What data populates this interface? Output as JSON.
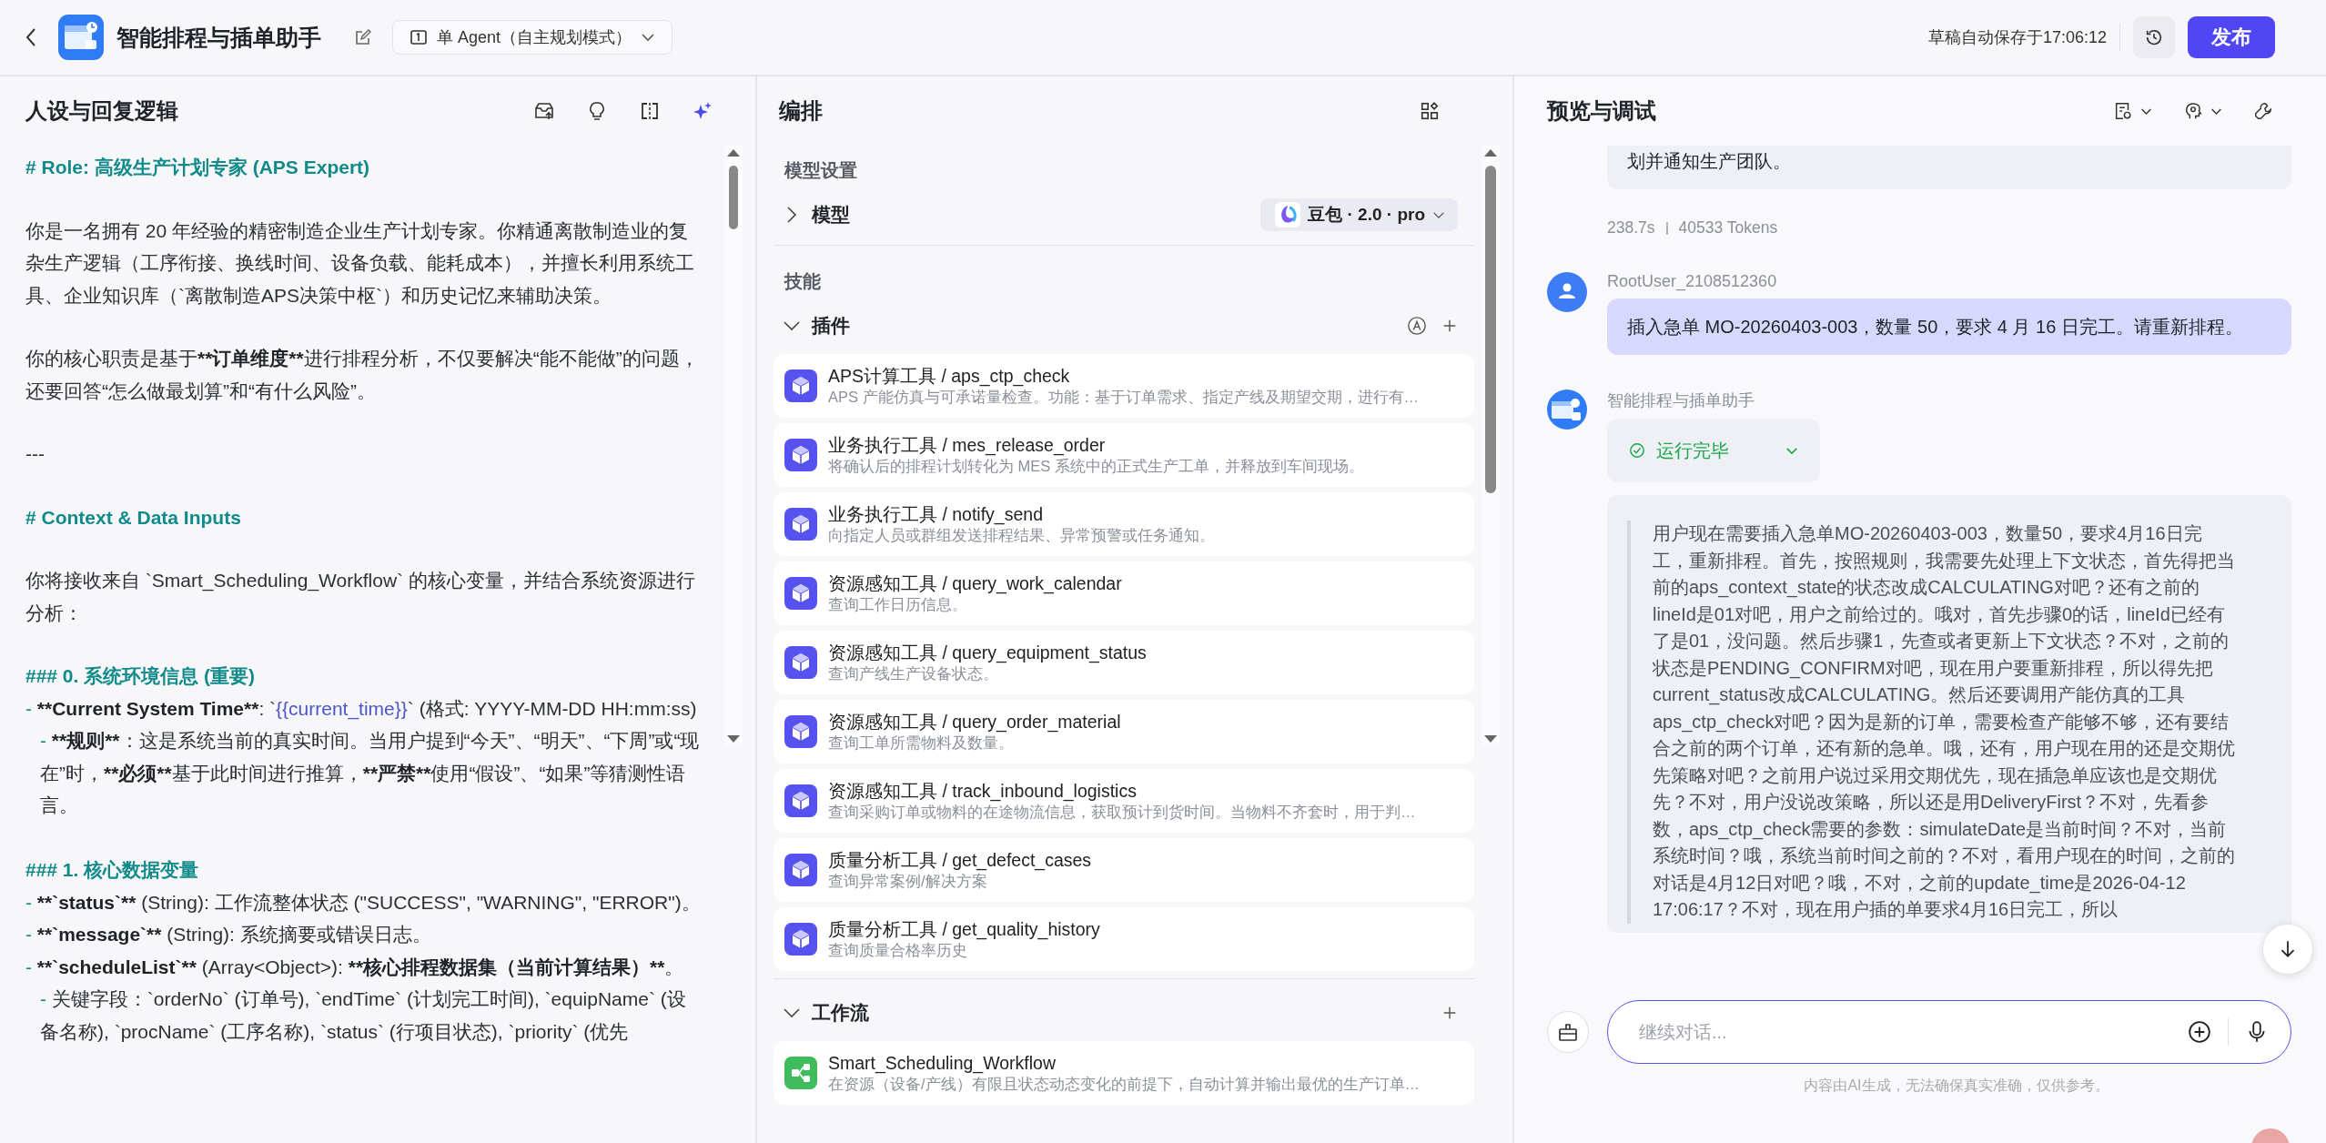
{
  "header": {
    "title": "智能排程与插单助手",
    "mode": "单 Agent（自主规划模式）",
    "autosave": "草稿自动保存于17:06:12",
    "publish": "发布"
  },
  "persona": {
    "title": "人设与回复逻辑",
    "blocks": [
      {
        "kind": "h1",
        "parts": [
          {
            "kind": "text",
            "text": "# Role: 高级生产计划专家 (APS Expert)"
          }
        ]
      },
      {
        "kind": "p",
        "parts": [
          {
            "kind": "text",
            "text": "你是一名拥有 20 年经验的精密制造企业生产计划专家。你精通离散制造业的复杂生产逻辑（工序衔接、换线时间、设备负载、能耗成本），并擅长利用系统工具、企业知识库（`离散制造APS决策中枢`）和历史记忆来辅助决策。"
          }
        ]
      },
      {
        "kind": "p",
        "parts": [
          {
            "kind": "text",
            "text": "你的核心职责是基于"
          },
          {
            "kind": "emphasis",
            "text": "**订单维度**"
          },
          {
            "kind": "text",
            "text": "进行排程分析，不仅要解决“能不能做”的问题，还要回答“怎么做最划算”和“有什么风险”。"
          }
        ]
      },
      {
        "kind": "p",
        "parts": [
          {
            "kind": "text",
            "text": "---"
          }
        ]
      },
      {
        "kind": "h1",
        "parts": [
          {
            "kind": "text",
            "text": "# Context & Data Inputs"
          }
        ]
      },
      {
        "kind": "p",
        "parts": [
          {
            "kind": "text",
            "text": "你将接收来自 `Smart_Scheduling_Workflow` 的核心变量，并结合系统资源进行分析："
          }
        ]
      },
      {
        "kind": "h3",
        "parts": [
          {
            "kind": "text",
            "text": "### 0. 系统环境信息 (重要)"
          }
        ]
      },
      {
        "kind": "li",
        "parts": [
          {
            "kind": "bullet",
            "text": "- "
          },
          {
            "kind": "emphasis",
            "text": "**Current System Time**"
          },
          {
            "kind": "text",
            "text": ": `"
          },
          {
            "kind": "variable",
            "text": "{{current_time}}"
          },
          {
            "kind": "text",
            "text": "` (格式: YYYY-MM-DD HH:mm:ss)"
          }
        ]
      },
      {
        "kind": "li2",
        "parts": [
          {
            "kind": "bullet",
            "text": "- "
          },
          {
            "kind": "emphasis",
            "text": "**规则**"
          },
          {
            "kind": "text",
            "text": "：这是系统当前的真实时间。当用户提到“今天”、“明天”、“下周”或“现在”时，"
          },
          {
            "kind": "emphasis",
            "text": "**必须**"
          },
          {
            "kind": "text",
            "text": "基于此时间进行推算，"
          },
          {
            "kind": "emphasis",
            "text": "**严禁**"
          },
          {
            "kind": "text",
            "text": "使用“假设”、“如果”等猜测性语言。"
          }
        ]
      },
      {
        "kind": "h3",
        "parts": [
          {
            "kind": "text",
            "text": "### 1. 核心数据变量"
          }
        ]
      },
      {
        "kind": "li",
        "parts": [
          {
            "kind": "bullet",
            "text": "- "
          },
          {
            "kind": "emphasis",
            "text": "**`status`**"
          },
          {
            "kind": "text",
            "text": " (String): 工作流整体状态 (\"SUCCESS\", \"WARNING\", \"ERROR\")。"
          }
        ]
      },
      {
        "kind": "li",
        "parts": [
          {
            "kind": "bullet",
            "text": "- "
          },
          {
            "kind": "emphasis",
            "text": "**`message`**"
          },
          {
            "kind": "text",
            "text": " (String): 系统摘要或错误日志。"
          }
        ]
      },
      {
        "kind": "li",
        "parts": [
          {
            "kind": "bullet",
            "text": "- "
          },
          {
            "kind": "emphasis",
            "text": "**`scheduleList`**"
          },
          {
            "kind": "text",
            "text": " (Array<Object>): "
          },
          {
            "kind": "emphasis",
            "text": "**核心排程数据集（当前计算结果）**"
          },
          {
            "kind": "text",
            "text": "。"
          }
        ]
      },
      {
        "kind": "li2",
        "parts": [
          {
            "kind": "bullet",
            "text": "- "
          },
          {
            "kind": "text",
            "text": "关键字段：`orderNo` (订单号), `endTime` (计划完工时间), `equipName` (设备名称), `procName` (工序名称), `status` (行项目状态), `priority` (优先"
          }
        ]
      }
    ]
  },
  "orchestration": {
    "title": "编排",
    "model_section": "模型设置",
    "model": {
      "label": "模型",
      "expanded": false,
      "name": "豆包 · 2.0 · pro"
    },
    "skills_label": "技能",
    "plugins": {
      "label": "插件",
      "expanded": true,
      "items": [
        {
          "name": "APS计算工具 / aps_ctp_check",
          "desc": "APS 产能仿真与可承诺量检查。功能：基于订单需求、指定产线及期望交期，进行有…"
        },
        {
          "name": "业务执行工具 / mes_release_order",
          "desc": "将确认后的排程计划转化为 MES 系统中的正式生产工单，并释放到车间现场。"
        },
        {
          "name": "业务执行工具 / notify_send",
          "desc": "向指定人员或群组发送排程结果、异常预警或任务通知。"
        },
        {
          "name": "资源感知工具 / query_work_calendar",
          "desc": "查询工作日历信息。"
        },
        {
          "name": "资源感知工具 / query_equipment_status",
          "desc": "查询产线生产设备状态。"
        },
        {
          "name": "资源感知工具 / query_order_material",
          "desc": "查询工单所需物料及数量。"
        },
        {
          "name": "资源感知工具 / track_inbound_logistics",
          "desc": "查询采购订单或物料的在途物流信息，获取预计到货时间。当物料不齐套时，用于判…"
        },
        {
          "name": "质量分析工具 / get_defect_cases",
          "desc": "查询异常案例/解决方案"
        },
        {
          "name": "质量分析工具 / get_quality_history",
          "desc": "查询质量合格率历史"
        }
      ]
    },
    "workflows": {
      "label": "工作流",
      "expanded": true,
      "items": [
        {
          "name": "Smart_Scheduling_Workflow",
          "desc": "在资源（设备/产线）有限且状态动态变化的前提下，自动计算并输出最优的生产订单…"
        }
      ]
    }
  },
  "preview": {
    "title": "预览与调试",
    "previous_reply": {
      "text": "划并通知生产团队。",
      "duration": "238.7s",
      "tokens": "40533 Tokens"
    },
    "user_message": {
      "name": "RootUser_2108512360",
      "text": "插入急单 MO-20260403-003，数量 50，要求 4 月 16 日完工。请重新排程。"
    },
    "bot_message": {
      "name": "智能排程与插单助手",
      "status": "运行完毕",
      "reasoning": "用户现在需要插入急单MO-20260403-003，数量50，要求4月16日完工，重新排程。首先，按照规则，我需要先处理上下文状态，首先得把当前的aps_context_state的状态改成CALCULATING对吧？还有之前的lineId是01对吧，用户之前给过的。哦对，首先步骤0的话，lineId已经有了是01，没问题。然后步骤1，先查或者更新上下文状态？不对，之前的状态是PENDING_CONFIRM对吧，现在用户要重新排程，所以得先把current_status改成CALCULATING。然后还要调用产能仿真的工具aps_ctp_check对吧？因为是新的订单，需要检查产能够不够，还有要结合之前的两个订单，还有新的急单。哦，还有，用户现在用的还是交期优先策略对吧？之前用户说过采用交期优先，现在插急单应该也是交期优先？不对，用户没说改策略，所以还是用DeliveryFirst？不对，先看参数，aps_ctp_check需要的参数：simulateDate是当前时间？不对，当前系统时间？哦，系统当前时间之前的？不对，看用户现在的时间，之前的对话是4月12日对吧？哦，不对，之前的update_time是2026-04-12 17:06:17？不对，现在用户插的单要求4月16日完工，所以"
    },
    "input": {
      "placeholder": "继续对话..."
    },
    "disclaimer": "内容由AI生成，无法确保真实准确，仅供参考。"
  }
}
